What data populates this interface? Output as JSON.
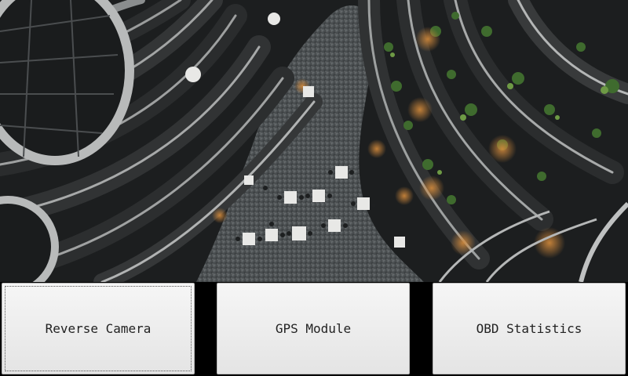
{
  "background": {
    "description_icon": "atrium-photo"
  },
  "menu": {
    "buttons": [
      {
        "id": "reverse_camera",
        "label": "Reverse Camera",
        "focused": true
      },
      {
        "id": "gps_module",
        "label": "GPS Module",
        "focused": false
      },
      {
        "id": "obd_statistics",
        "label": "OBD Statistics",
        "focused": false
      }
    ]
  },
  "colors": {
    "button_face": "#ededed",
    "button_border": "#b9b9b9",
    "button_text": "#222222",
    "bar_background": "#000000"
  }
}
